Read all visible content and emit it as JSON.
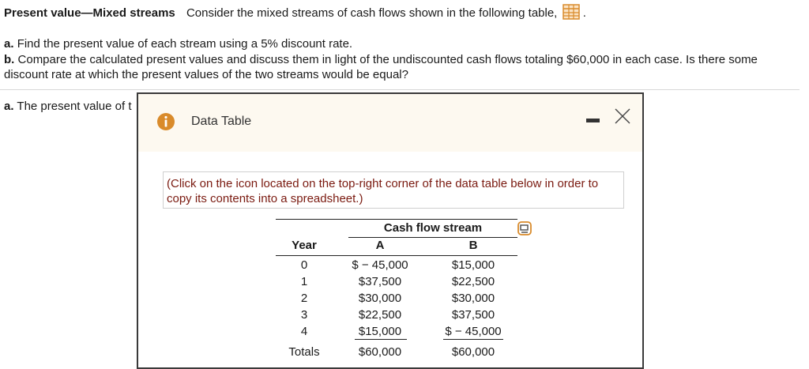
{
  "problem": {
    "topic": "Present value—Mixed streams",
    "intro": "Consider the mixed streams of cash flows shown in the following table,",
    "intro_end": ".",
    "part_a_label": "a.",
    "part_a_text": "Find the present value of each stream using a 5% discount rate.",
    "part_b_label": "b.",
    "part_b_text_line1": "Compare the calculated present values and discuss them in light of the undiscounted cash flows totaling $60,000 in each case. Is there some",
    "part_b_text_line2": "discount rate at which the present values of the two streams would be equal?",
    "answer_a_prefix": "a.",
    "answer_a_text": "The present value of t"
  },
  "modal": {
    "title": "Data Table",
    "note_line1": "(Click on the icon located on the top-right corner of the data table below in order to",
    "note_line2": "copy its contents into a spreadsheet.)",
    "icons": {
      "info": "info-icon",
      "minimize": "minimize-icon",
      "close": "close-icon",
      "copy": "copy-spreadsheet-icon",
      "table": "data-table-icon"
    }
  },
  "table": {
    "group_header": "Cash flow stream",
    "col_year": "Year",
    "col_a": "A",
    "col_b": "B",
    "rows": [
      {
        "year": "0",
        "a": "$ − 45,000",
        "b": "$15,000"
      },
      {
        "year": "1",
        "a": "$37,500",
        "b": "$22,500"
      },
      {
        "year": "2",
        "a": "$30,000",
        "b": "$30,000"
      },
      {
        "year": "3",
        "a": "$22,500",
        "b": "$37,500"
      },
      {
        "year": "4",
        "a": "$15,000",
        "b": "$ − 45,000"
      }
    ],
    "totals_label": "Totals",
    "totals_a": "$60,000",
    "totals_b": "$60,000"
  },
  "colors": {
    "accent_orange": "#d98b2b",
    "note_red": "#7a1a10",
    "modal_header_bg": "#fdf9f0"
  }
}
